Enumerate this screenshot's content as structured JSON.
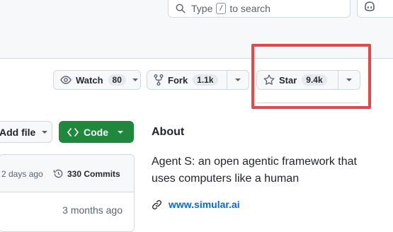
{
  "header": {
    "search": {
      "prefix": "Type",
      "key": "/",
      "suffix": "to search"
    }
  },
  "repo_actions": {
    "watch": {
      "label": "Watch",
      "count": "80"
    },
    "fork": {
      "label": "Fork",
      "count": "1.1k"
    },
    "star": {
      "label": "Star",
      "count": "9.4k"
    }
  },
  "toolbar": {
    "add_file": "Add file",
    "code": "Code"
  },
  "files": {
    "last_commit_ago": "2 days ago",
    "commits_label": "330 Commits",
    "row_time": "3 months ago"
  },
  "about": {
    "title": "About",
    "description": "Agent S: an open agentic framework that uses computers like a human",
    "link": "www.simular.ai"
  },
  "colors": {
    "highlight": "#e4484a",
    "code_button": "#1f883d",
    "link": "#0969da"
  }
}
